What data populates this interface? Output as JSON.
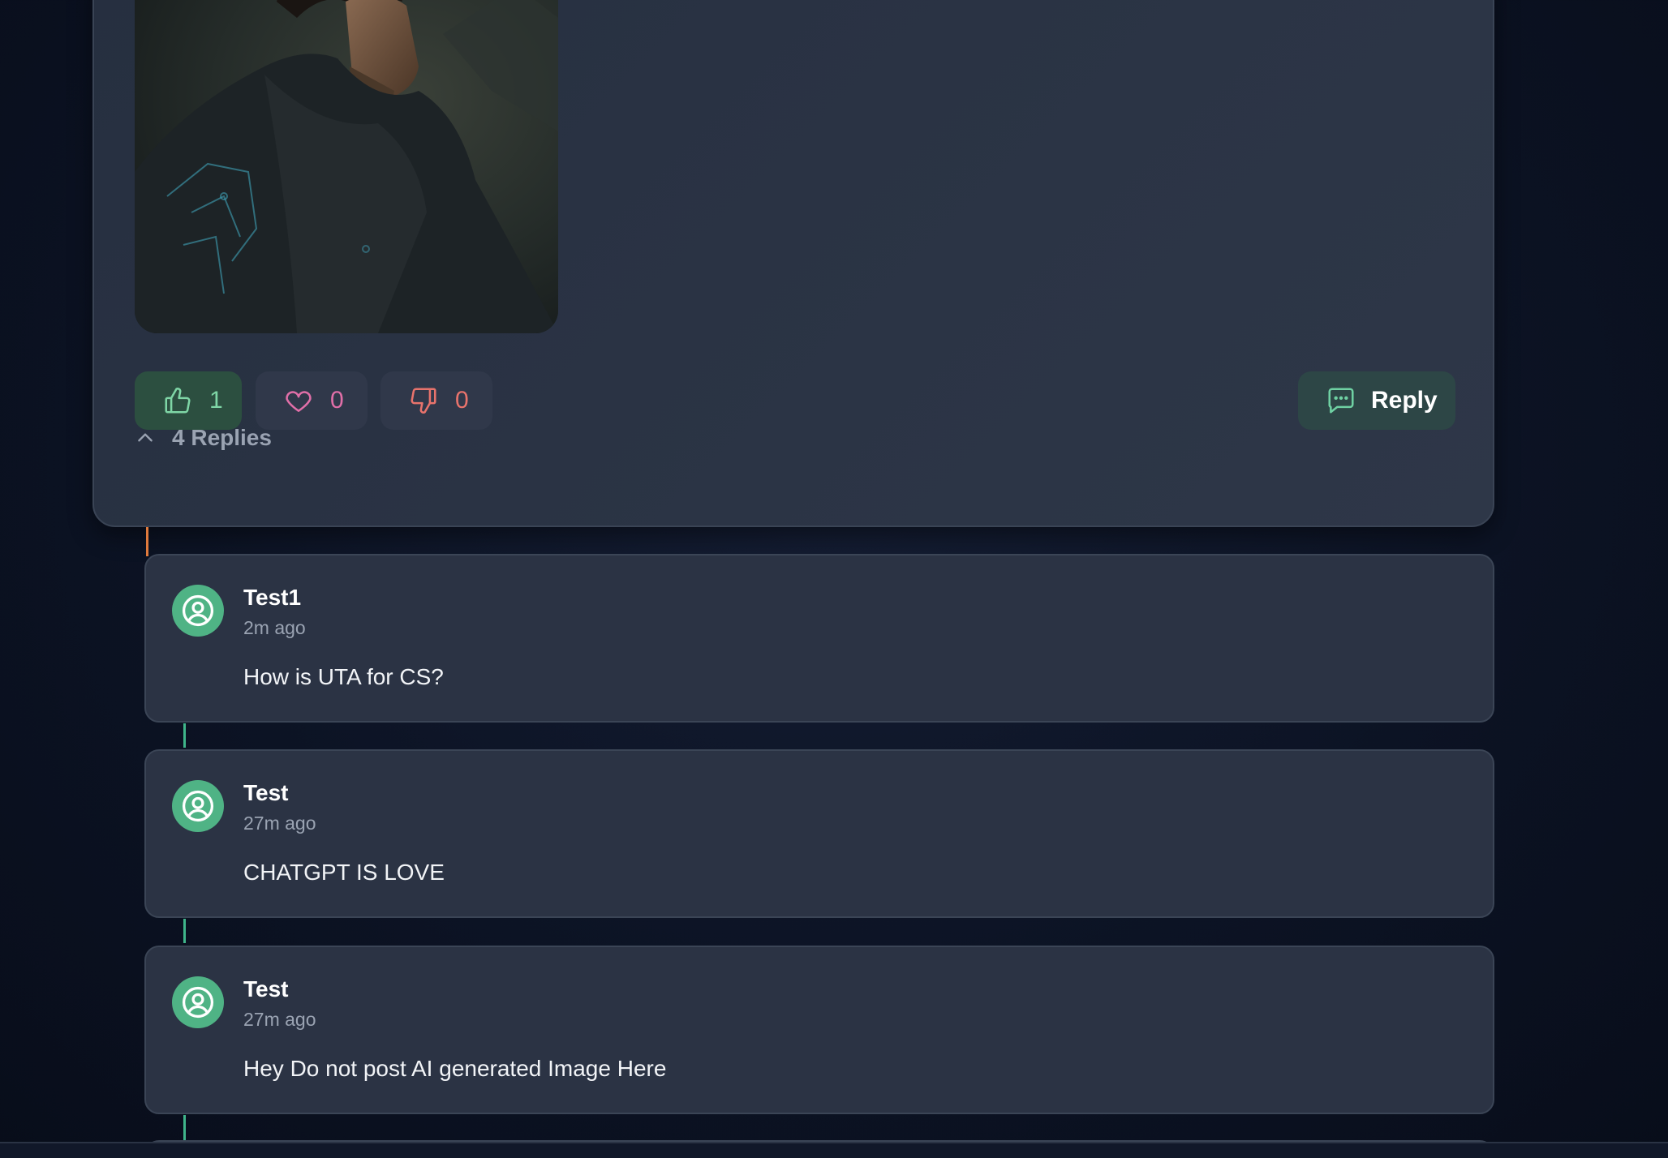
{
  "post": {
    "image_alt": "Portrait of a man in a dark hooded cloak",
    "reactions": {
      "like_count": "1",
      "heart_count": "0",
      "dislike_count": "0"
    },
    "reply_label": "Reply",
    "replies_label": "4 Replies"
  },
  "replies": [
    {
      "author": "Test1",
      "time": "2m ago",
      "text": "How is UTA for CS?"
    },
    {
      "author": "Test",
      "time": "27m ago",
      "text": "CHATGPT IS LOVE"
    },
    {
      "author": "Test",
      "time": "27m ago",
      "text": "Hey Do not post AI generated Image Here"
    }
  ],
  "colors": {
    "background": "#0c1324",
    "card": "#2b3445",
    "like_green": "#7fd6a6",
    "heart_pink": "#e06fa8",
    "dislike_red": "#e8736c",
    "avatar_green": "#4fb385",
    "thread_orange": "#e07a3c",
    "thread_teal": "#3fb58a"
  },
  "icons": [
    "thumbs-up-icon",
    "heart-icon",
    "thumbs-down-icon",
    "chat-bubble-icon",
    "chevron-up-icon",
    "user-circle-icon"
  ]
}
